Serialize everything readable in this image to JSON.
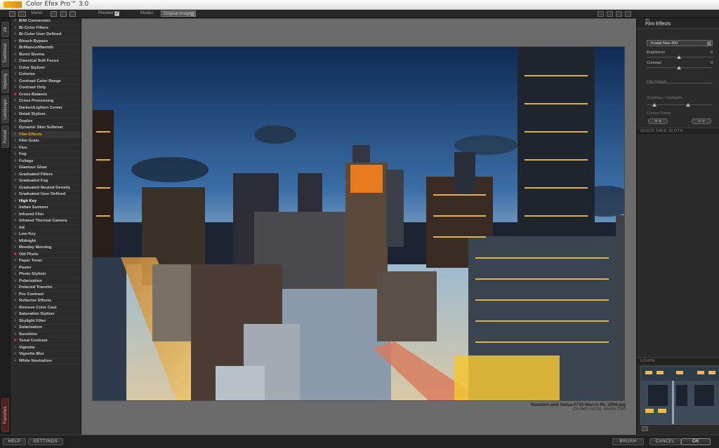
{
  "window": {
    "title": "Color Efex Pro™ 3.0"
  },
  "toolbar": {
    "views_label": "Views:",
    "preview_label": "Preview:",
    "preview_checked": "✔",
    "modes_label": "Modes:",
    "mode_value": "Original Image"
  },
  "tabs": [
    "All",
    "Traditional",
    "Stylizing",
    "Landscape",
    "Portrait"
  ],
  "favorites_tab": "Favorites",
  "filters": [
    {
      "label": "B/W Conversion",
      "fav": false
    },
    {
      "label": "Bi-Color Filters",
      "fav": false
    },
    {
      "label": "Bi-Color User Defined",
      "fav": false
    },
    {
      "label": "Bleach Bypass",
      "fav": false
    },
    {
      "label": "Brilliance/Warmth",
      "fav": false
    },
    {
      "label": "Burnt Sienna",
      "fav": false
    },
    {
      "label": "Classical Soft Focus",
      "fav": false
    },
    {
      "label": "Color Stylizer",
      "fav": false
    },
    {
      "label": "Colorize",
      "fav": false
    },
    {
      "label": "Contrast Color Range",
      "fav": false
    },
    {
      "label": "Contrast Only",
      "fav": false
    },
    {
      "label": "Cross Balance",
      "fav": true
    },
    {
      "label": "Cross Processing",
      "fav": false
    },
    {
      "label": "Darken/Lighten Center",
      "fav": false
    },
    {
      "label": "Detail Stylizer",
      "fav": false
    },
    {
      "label": "Duplex",
      "fav": false
    },
    {
      "label": "Dynamic Skin Softener",
      "fav": false
    },
    {
      "label": "Film Effects",
      "fav": false,
      "active": true
    },
    {
      "label": "Film Grain",
      "fav": false
    },
    {
      "label": "Flux",
      "fav": false
    },
    {
      "label": "Fog",
      "fav": false
    },
    {
      "label": "Foliage",
      "fav": false
    },
    {
      "label": "Glamour Glow",
      "fav": false
    },
    {
      "label": "Graduated Filters",
      "fav": false
    },
    {
      "label": "Graduated Fog",
      "fav": false
    },
    {
      "label": "Graduated Neutral Density",
      "fav": false
    },
    {
      "label": "Graduated User Defined",
      "fav": false
    },
    {
      "label": "High Key",
      "fav": false,
      "bright": true
    },
    {
      "label": "Indian Summer",
      "fav": false
    },
    {
      "label": "Infrared Film",
      "fav": false
    },
    {
      "label": "Infrared Thermal Camera",
      "fav": false
    },
    {
      "label": "Ink",
      "fav": false
    },
    {
      "label": "Low Key",
      "fav": false
    },
    {
      "label": "Midnight",
      "fav": false
    },
    {
      "label": "Monday Morning",
      "fav": false
    },
    {
      "label": "Old Photo",
      "fav": true
    },
    {
      "label": "Paper Toner",
      "fav": false
    },
    {
      "label": "Pastel",
      "fav": false
    },
    {
      "label": "Photo Stylizer",
      "fav": false
    },
    {
      "label": "Polarization",
      "fav": false
    },
    {
      "label": "Polaroid Transfer",
      "fav": false
    },
    {
      "label": "Pro Contrast",
      "fav": false
    },
    {
      "label": "Reflector Effects",
      "fav": false
    },
    {
      "label": "Remove Color Cast",
      "fav": false
    },
    {
      "label": "Saturation Stylizer",
      "fav": false
    },
    {
      "label": "Skylight Filter",
      "fav": false
    },
    {
      "label": "Solarization",
      "fav": false
    },
    {
      "label": "Sunshine",
      "fav": false
    },
    {
      "label": "Tonal Contrast",
      "fav": true
    },
    {
      "label": "Vignette",
      "fav": false
    },
    {
      "label": "Vignette Blur",
      "fav": false
    },
    {
      "label": "White Neutralizer",
      "fav": false
    }
  ],
  "image": {
    "caption": "Houston and Salsa-2733-March 09, 2009.jpg",
    "meta": "(24-4MP, ISO 50, NIKON D3X)"
  },
  "panel": {
    "category": "All",
    "title": "Film Effects",
    "film_type": "Kodak Max 400",
    "brightness_label": "Brightness",
    "brightness_value": "0",
    "contrast_label": "Contrast",
    "contrast_value": "0",
    "film_details": "Film Details",
    "shadows_highlights": "Shadows / Highlights",
    "control_points": "Control Points",
    "quick_save": "QUICK SAVE SLOTS",
    "loupe": "LOUPE"
  },
  "buttons": {
    "help": "HELP",
    "settings": "SETTINGS",
    "brush": "BRUSH",
    "cancel": "CANCEL",
    "ok": "OK"
  },
  "colors": {
    "active_filter": "#f2a51a",
    "favorite_star": "#dd3333",
    "canvas_bg": "#6b6b6b"
  }
}
